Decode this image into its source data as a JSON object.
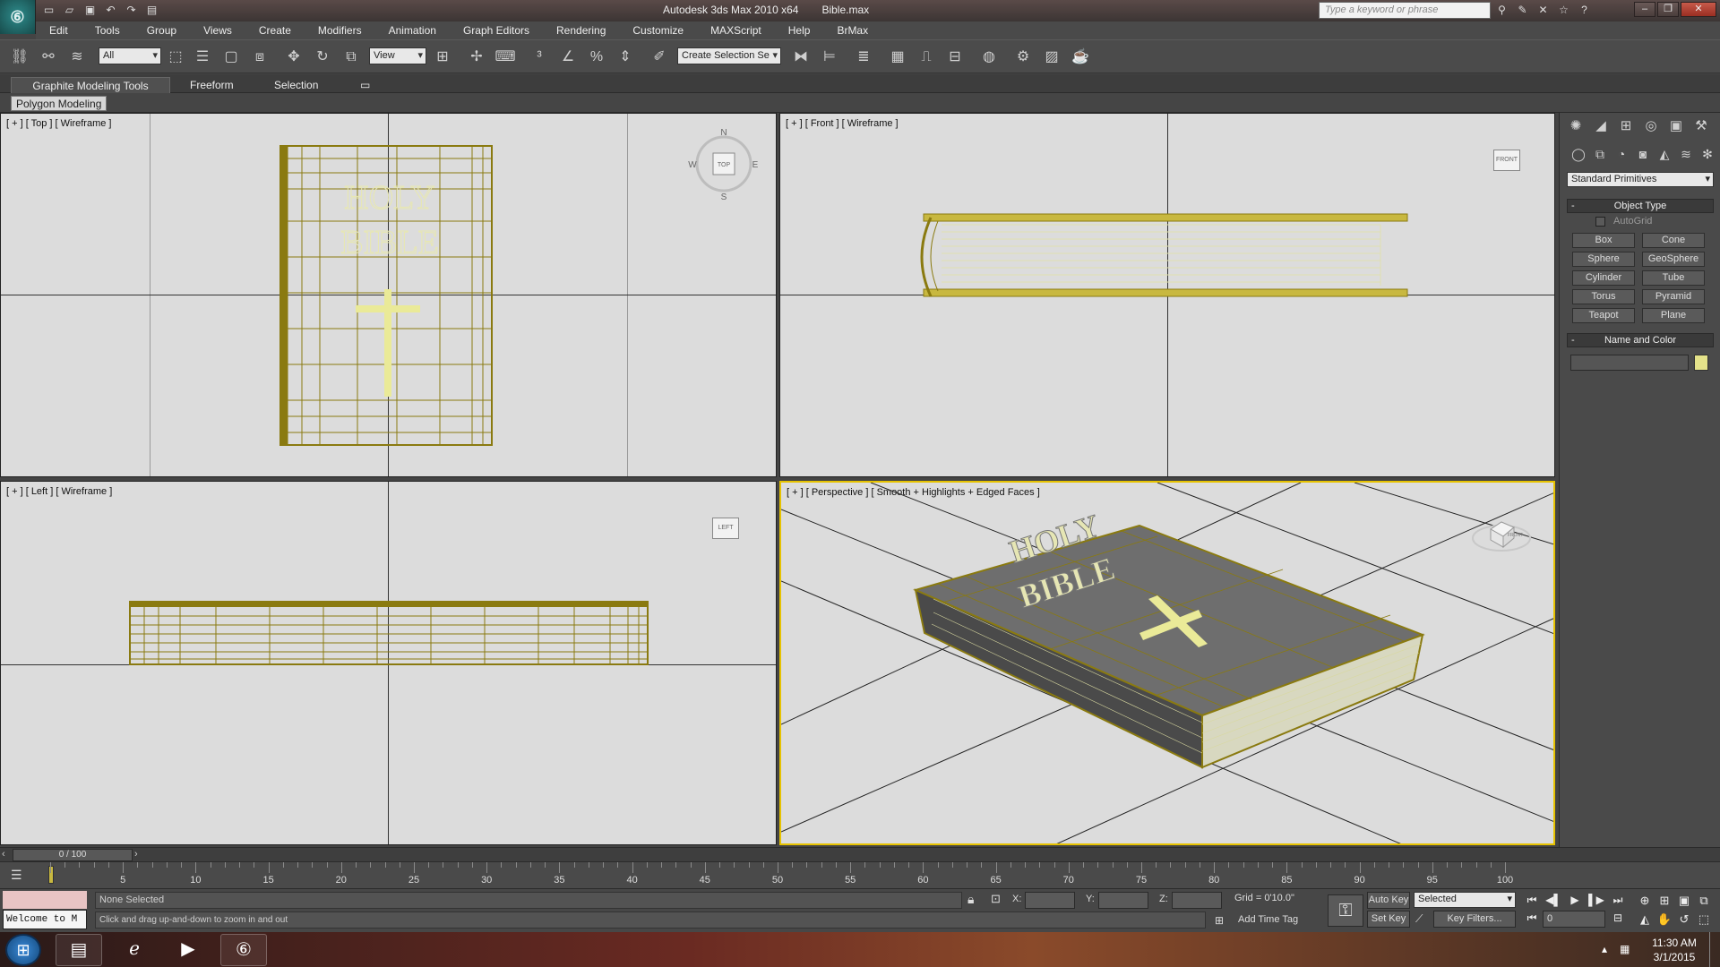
{
  "titlebar": {
    "app_title": "Autodesk 3ds Max  2010 x64",
    "file_name": "Bible.max",
    "search_placeholder": "Type a keyword or phrase",
    "logo": "3ds-max-logo"
  },
  "menubar": {
    "items": [
      "Edit",
      "Tools",
      "Group",
      "Views",
      "Create",
      "Modifiers",
      "Animation",
      "Graph Editors",
      "Rendering",
      "Customize",
      "MAXScript",
      "Help",
      "BrMax"
    ]
  },
  "toolbar": {
    "filter_select": "All",
    "ref_coord_select": "View",
    "named_selection": "Create Selection Se"
  },
  "ribbon": {
    "tabs": [
      "Graphite Modeling Tools",
      "Freeform",
      "Selection"
    ],
    "panel_label": "Polygon Modeling"
  },
  "viewports": {
    "top": {
      "label": "[ + ] [ Top ] [ Wireframe ]",
      "cube_label": "TOP",
      "compass": [
        "N",
        "E",
        "S",
        "W"
      ]
    },
    "front": {
      "label": "[ + ] [ Front ] [ Wireframe ]",
      "cube_label": "FRONT"
    },
    "left": {
      "label": "[ + ] [ Left ] [ Wireframe ]",
      "cube_label": "LEFT"
    },
    "perspective": {
      "label": "[ + ] [ Perspective ] [ Smooth + Highlights + Edged Faces ]",
      "cube_label": "FRONT"
    }
  },
  "book": {
    "title_line1": "HOLY",
    "title_line2": "BIBLE"
  },
  "command_panel": {
    "category": "Standard Primitives",
    "object_type_title": "Object Type",
    "autogrid_label": "AutoGrid",
    "primitives": [
      "Box",
      "Cone",
      "Sphere",
      "GeoSphere",
      "Cylinder",
      "Tube",
      "Torus",
      "Pyramid",
      "Teapot",
      "Plane"
    ],
    "name_color_title": "Name and Color",
    "object_color": "#e4e28a"
  },
  "timeline": {
    "slider_text": "0 / 100",
    "ticks": [
      5,
      10,
      15,
      20,
      25,
      30,
      35,
      40,
      45,
      50,
      55,
      60,
      65,
      70,
      75,
      80,
      85,
      90,
      95,
      100
    ]
  },
  "status": {
    "welcome": "Welcome to M",
    "selection": "None Selected",
    "prompt": "Click and drag up-and-down to zoom in and out",
    "x_label": "X:",
    "y_label": "Y:",
    "z_label": "Z:",
    "grid": "Grid = 0'10.0\"",
    "add_time_tag": "Add Time Tag",
    "auto_key": "Auto Key",
    "set_key": "Set Key",
    "key_mode": "Selected",
    "key_filters": "Key Filters...",
    "frame": "0"
  },
  "taskbar": {
    "time": "11:30 AM",
    "date": "3/1/2015"
  },
  "colors": {
    "wire": "#8a7a10",
    "wire_light": "#e8e8a0",
    "active_border": "#e6c200",
    "viewport_bg": "#dcdcdc"
  }
}
